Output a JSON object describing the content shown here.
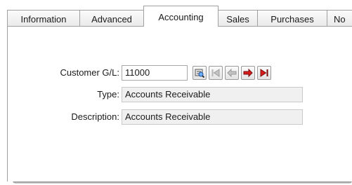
{
  "tabs": [
    {
      "label": "Information"
    },
    {
      "label": "Advanced"
    },
    {
      "label": "Accounting"
    },
    {
      "label": "Sales"
    },
    {
      "label": "Purchases"
    },
    {
      "label": "No"
    }
  ],
  "active_tab": "Accounting",
  "accounting": {
    "customer_gl": {
      "label": "Customer G/L:",
      "value": "11000"
    },
    "type": {
      "label": "Type:",
      "value": "Accounts Receivable"
    },
    "description": {
      "label": "Description:",
      "value": "Accounts Receivable"
    }
  },
  "toolbar_icons": [
    "lookup-icon",
    "first-record-icon",
    "previous-record-icon",
    "next-record-icon",
    "last-record-icon"
  ],
  "colors": {
    "accent_red": "#d81b1b",
    "disabled_gray": "#b5b5b5"
  }
}
